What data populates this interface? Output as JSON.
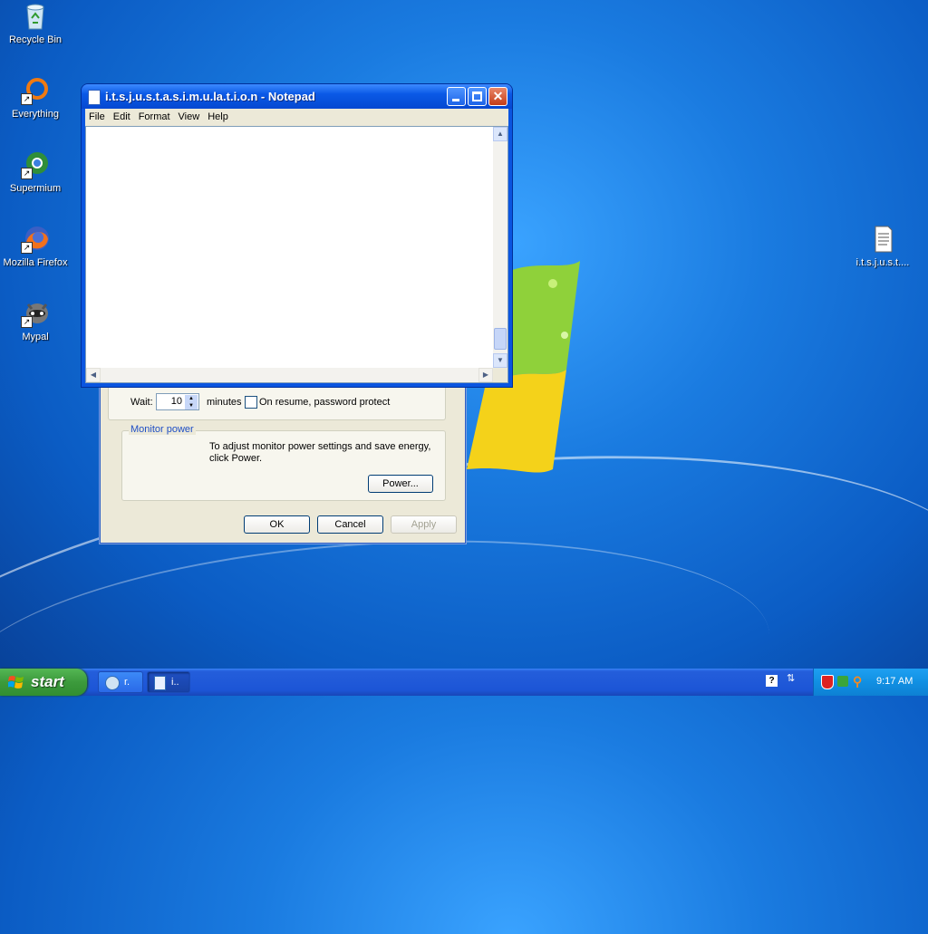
{
  "desktop": {
    "icons": [
      {
        "label": "Recycle Bin",
        "icon": "recycle-bin-icon"
      },
      {
        "label": "Everything",
        "icon": "everything-search-icon"
      },
      {
        "label": "Supermium",
        "icon": "supermium-browser-icon"
      },
      {
        "label": "Mozilla Firefox",
        "icon": "firefox-icon"
      },
      {
        "label": "Mypal",
        "icon": "mypal-browser-icon"
      },
      {
        "label": "i.t.s.j.u.s.t....",
        "icon": "text-file-icon"
      }
    ]
  },
  "notepad": {
    "title": "i.t.s.j.u.s.t.a.s.i.m.u.la.t.i.o.n - Notepad",
    "menu": [
      "File",
      "Edit",
      "Format",
      "View",
      "Help"
    ],
    "content": ""
  },
  "screensaver_dialog": {
    "wait_label": "Wait:",
    "wait_value": "10",
    "minutes_label": "minutes",
    "resume_label": "On resume, password protect",
    "monitor_power_title": "Monitor power",
    "monitor_power_text": "To adjust monitor power settings and save energy, click Power.",
    "power_button": "Power...",
    "ok_button": "OK",
    "cancel_button": "Cancel",
    "apply_button": "Apply"
  },
  "taskbar": {
    "start_label": "start",
    "tasks": [
      {
        "label": "r.",
        "icon": "display-properties-icon",
        "active": false
      },
      {
        "label": "i..",
        "icon": "notepad-icon",
        "active": true
      }
    ],
    "clock": "9:17 AM"
  },
  "colors": {
    "taskbar_blue": "#245edb",
    "start_green": "#3c9a3c",
    "titlebar_blue": "#0a59e6"
  }
}
